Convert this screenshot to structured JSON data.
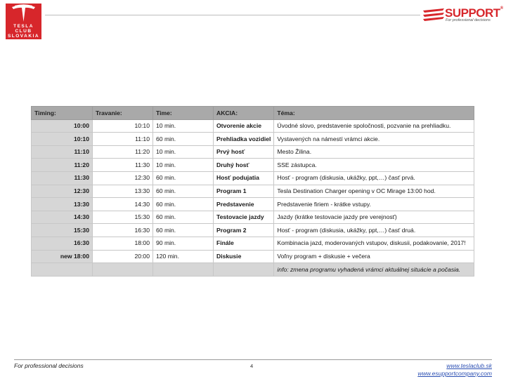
{
  "header": {
    "logo_lines": [
      "TESLA",
      "CLUB",
      "SLOVAKIA"
    ],
    "partner_name": "SUPPORT",
    "partner_reg": "®",
    "partner_tagline": "For professional decisions"
  },
  "table": {
    "headers": [
      "Timing:",
      "Travanie:",
      "Time:",
      "AKCIA:",
      "Téma:"
    ],
    "rows": [
      [
        "10:00",
        "10:10",
        "10 min.",
        "Otvorenie akcie",
        "Úvodné slovo, predstavenie spoločnosti, pozvanie na prehliadku."
      ],
      [
        "10:10",
        "11:10",
        "60 min.",
        "Prehliadka vozidiel",
        "Vystavených na námestí vrámci akcie."
      ],
      [
        "11:10",
        "11:20",
        "10 min.",
        "Prvý hosť",
        "Mesto Žilina."
      ],
      [
        "11:20",
        "11:30",
        "10 min.",
        "Druhý hosť",
        "SSE zástupca."
      ],
      [
        "11:30",
        "12:30",
        "60 min.",
        "Hosť podujatia",
        "Hosť - program (diskusia, ukážky, ppt,…) časť prvá."
      ],
      [
        "12:30",
        "13:30",
        "60 min.",
        "Program 1",
        "Tesla Destination Charger opening v OC Mirage 13:00 hod."
      ],
      [
        "13:30",
        "14:30",
        "60 min.",
        "Predstavenie",
        "Predstavenie firiem - krátke vstupy."
      ],
      [
        "14:30",
        "15:30",
        "60 min.",
        "Testovacie jazdy",
        "Jazdy (krátke testovacie jazdy pre verejnosť)"
      ],
      [
        "15:30",
        "16:30",
        "60 min.",
        "Program 2",
        "Hosť - program (diskusia, ukážky, ppt,…) časť druá."
      ],
      [
        "16:30",
        "18:00",
        "90 min.",
        "Finále",
        "Kombinacia jazd, moderovaných vstupov, diskusii, podakovanie, 2017!"
      ],
      [
        "new 18:00",
        "20:00",
        "120 min.",
        "Diskusie",
        "Voľny program + diskusie + večera"
      ]
    ],
    "note": "info: zmena programu vyhadená vrámci aktuálnej situácie a počasia."
  },
  "footer": {
    "left": "For professional decisions",
    "page": "4",
    "link1": "www.teslaclub.sk",
    "link2": "www.esupportcompany.com"
  },
  "colors": {
    "brand_red": "#d7262b",
    "header_gray": "#a9a9a9",
    "timing_gray": "#d6d6d6",
    "link_blue": "#2b4fb3"
  }
}
